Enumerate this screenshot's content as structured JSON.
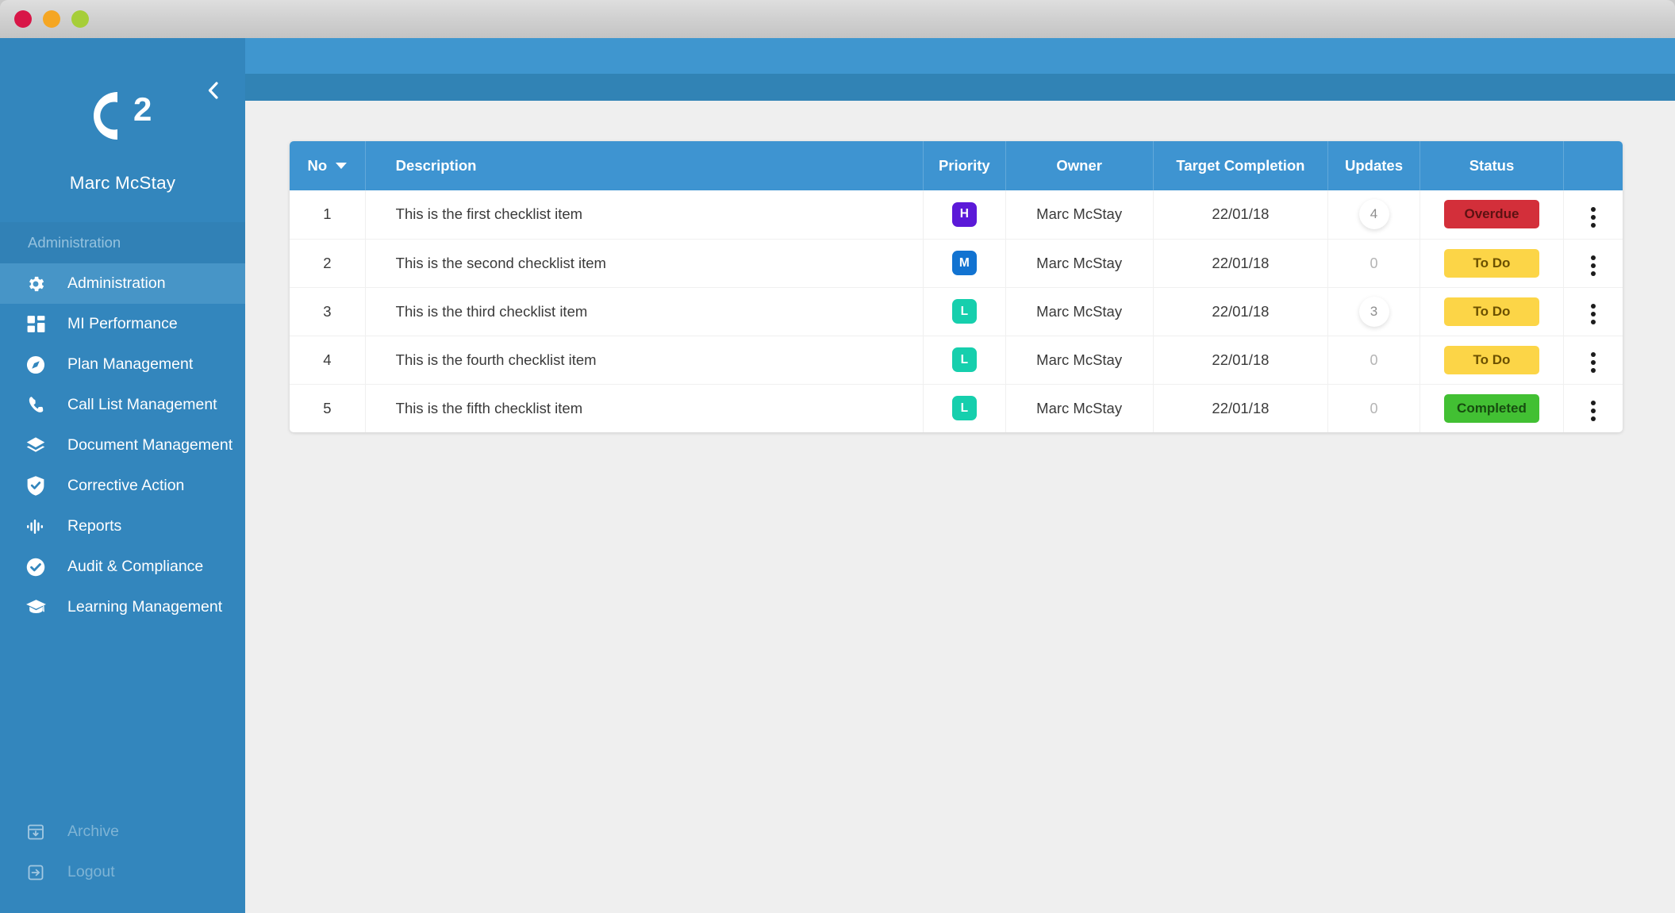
{
  "window": {
    "traffic_lights": [
      {
        "name": "close-button",
        "color": "#d81647"
      },
      {
        "name": "minimize-button",
        "color": "#f5a623"
      },
      {
        "name": "maximize-button",
        "color": "#a6ce39"
      }
    ]
  },
  "sidebar": {
    "collapse_icon": "chevron-left-icon",
    "logo_text": "C2",
    "logo_letter": "C",
    "logo_sub": "2",
    "user_name": "Marc McStay",
    "section_label": "Administration",
    "items": [
      {
        "label": "Administration",
        "icon": "gear-icon",
        "active": true
      },
      {
        "label": "MI Performance",
        "icon": "dashboard-icon",
        "active": false
      },
      {
        "label": "Plan Management",
        "icon": "compass-icon",
        "active": false
      },
      {
        "label": "Call List Management",
        "icon": "phone-icon",
        "active": false
      },
      {
        "label": "Document Management",
        "icon": "layers-icon",
        "active": false
      },
      {
        "label": "Corrective Action",
        "icon": "shield-check-icon",
        "active": false
      },
      {
        "label": "Reports",
        "icon": "waveform-icon",
        "active": false
      },
      {
        "label": "Audit & Compliance",
        "icon": "check-circle-icon",
        "active": false
      },
      {
        "label": "Learning Management",
        "icon": "graduation-cap-icon",
        "active": false
      }
    ],
    "bottom_items": [
      {
        "label": "Archive",
        "icon": "archive-icon"
      },
      {
        "label": "Logout",
        "icon": "logout-icon"
      }
    ]
  },
  "table": {
    "columns": {
      "no": "No",
      "description": "Description",
      "priority": "Priority",
      "owner": "Owner",
      "target_completion": "Target Completion",
      "updates": "Updates",
      "status": "Status"
    },
    "sort": {
      "column": "No",
      "direction": "desc",
      "icon": "caret-down-icon"
    },
    "row_menu_icon": "kebab-menu-icon",
    "rows": [
      {
        "no": "1",
        "description": "This is the first checklist item",
        "priority": "H",
        "priority_color": "#5b19d8",
        "owner": "Marc McStay",
        "target_completion": "22/01/18",
        "updates": "4",
        "updates_badge": true,
        "status": "Overdue",
        "status_bg": "#d32f3a",
        "status_fg": "#5c1212"
      },
      {
        "no": "2",
        "description": "This is the second checklist item",
        "priority": "M",
        "priority_color": "#1273d1",
        "owner": "Marc McStay",
        "target_completion": "22/01/18",
        "updates": "0",
        "updates_badge": false,
        "status": "To Do",
        "status_bg": "#fcd547",
        "status_fg": "#6b5000"
      },
      {
        "no": "3",
        "description": "This is the third checklist item",
        "priority": "L",
        "priority_color": "#16cfad",
        "owner": "Marc McStay",
        "target_completion": "22/01/18",
        "updates": "3",
        "updates_badge": true,
        "status": "To Do",
        "status_bg": "#fcd547",
        "status_fg": "#6b5000"
      },
      {
        "no": "4",
        "description": "This is the fourth checklist item",
        "priority": "L",
        "priority_color": "#16cfad",
        "owner": "Marc McStay",
        "target_completion": "22/01/18",
        "updates": "0",
        "updates_badge": false,
        "status": "To Do",
        "status_bg": "#fcd547",
        "status_fg": "#6b5000"
      },
      {
        "no": "5",
        "description": "This is the fifth checklist item",
        "priority": "L",
        "priority_color": "#16cfad",
        "owner": "Marc McStay",
        "target_completion": "22/01/18",
        "updates": "0",
        "updates_badge": false,
        "status": "Completed",
        "status_bg": "#42c033",
        "status_fg": "#174d10"
      }
    ]
  },
  "colors": {
    "sidebar_bg": "#3386bd",
    "sidebar_active": "#4795c7",
    "sidebar_section": "#3181b6",
    "topbar": "#3f96cf",
    "subbar": "#3183b5",
    "content_bg": "#efefef",
    "table_header": "#3e94d1"
  }
}
